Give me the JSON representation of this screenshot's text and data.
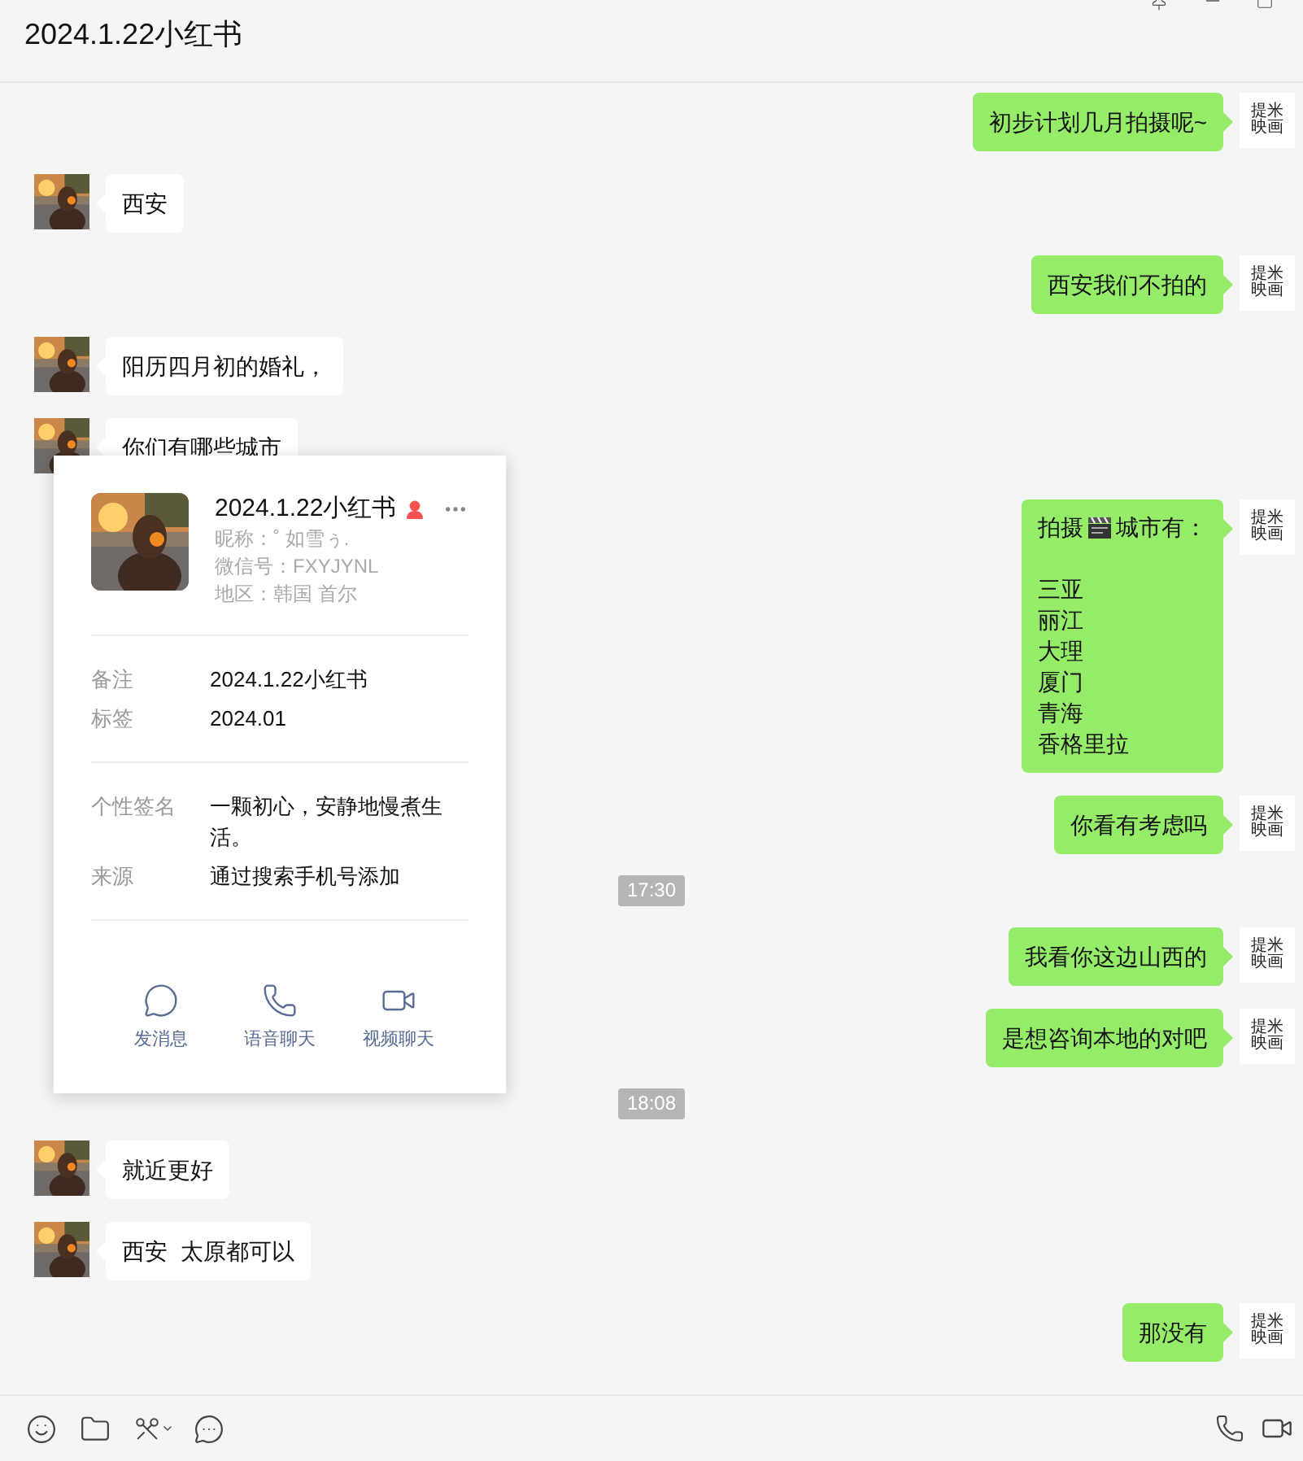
{
  "window": {
    "title": "2024.1.22小红书"
  },
  "messages": [
    {
      "kind": "text",
      "outgoing": true,
      "avatar_text": [
        "提米",
        "映画"
      ],
      "text": "初步计划几月拍摄呢~"
    },
    {
      "kind": "text",
      "outgoing": false,
      "text": "西安"
    },
    {
      "kind": "text",
      "outgoing": true,
      "avatar_text": [
        "提米",
        "映画"
      ],
      "text": "西安我们不拍的"
    },
    {
      "kind": "text",
      "outgoing": false,
      "text": "阳历四月初的婚礼，"
    },
    {
      "kind": "text",
      "outgoing": false,
      "text": "你们有哪些城市"
    },
    {
      "kind": "lines",
      "outgoing": true,
      "avatar_text": [
        "提米",
        "映画"
      ],
      "lines": [
        {
          "kind": "with-icon",
          "before": "拍摄",
          "after": "城市有："
        },
        {
          "kind": "blank"
        },
        {
          "kind": "text",
          "text": "三亚"
        },
        {
          "kind": "text",
          "text": "丽江"
        },
        {
          "kind": "text",
          "text": "大理"
        },
        {
          "kind": "text",
          "text": "厦门"
        },
        {
          "kind": "text",
          "text": "青海"
        },
        {
          "kind": "text",
          "text": "香格里拉"
        }
      ]
    },
    {
      "kind": "text",
      "outgoing": true,
      "avatar_text": [
        "提米",
        "映画"
      ],
      "text": "你看有考虑吗"
    },
    {
      "kind": "time",
      "text": "17:30"
    },
    {
      "kind": "text",
      "outgoing": true,
      "avatar_text": [
        "提米",
        "映画"
      ],
      "text": "我看你这边山西的"
    },
    {
      "kind": "text",
      "outgoing": true,
      "avatar_text": [
        "提米",
        "映画"
      ],
      "text": "是想咨询本地的对吧"
    },
    {
      "kind": "time",
      "text": "18:08"
    },
    {
      "kind": "text",
      "outgoing": false,
      "text": "就近更好"
    },
    {
      "kind": "text",
      "outgoing": false,
      "text": "西安  太原都可以"
    },
    {
      "kind": "text",
      "outgoing": true,
      "avatar_text": [
        "提米",
        "映画"
      ],
      "text": "那没有"
    }
  ],
  "profile_card": {
    "name": "2024.1.22小红书",
    "female": true,
    "info": [
      "昵称：˚ 如雪ぅ.",
      "微信号：FXYJYNL",
      "地区：韩国 首尔"
    ],
    "sections": [
      [
        {
          "label": "备注",
          "value": "2024.1.22小红书"
        },
        {
          "label": "标签",
          "value": "2024.01"
        }
      ],
      [
        {
          "label": "个性签名",
          "value": "一颗初心，安静地慢煮生活。"
        },
        {
          "label": "来源",
          "value": "通过搜索手机号添加"
        }
      ]
    ],
    "actions": [
      {
        "kind": "message",
        "label": "发消息"
      },
      {
        "kind": "voice",
        "label": "语音聊天"
      },
      {
        "kind": "video",
        "label": "视频聊天"
      }
    ]
  }
}
